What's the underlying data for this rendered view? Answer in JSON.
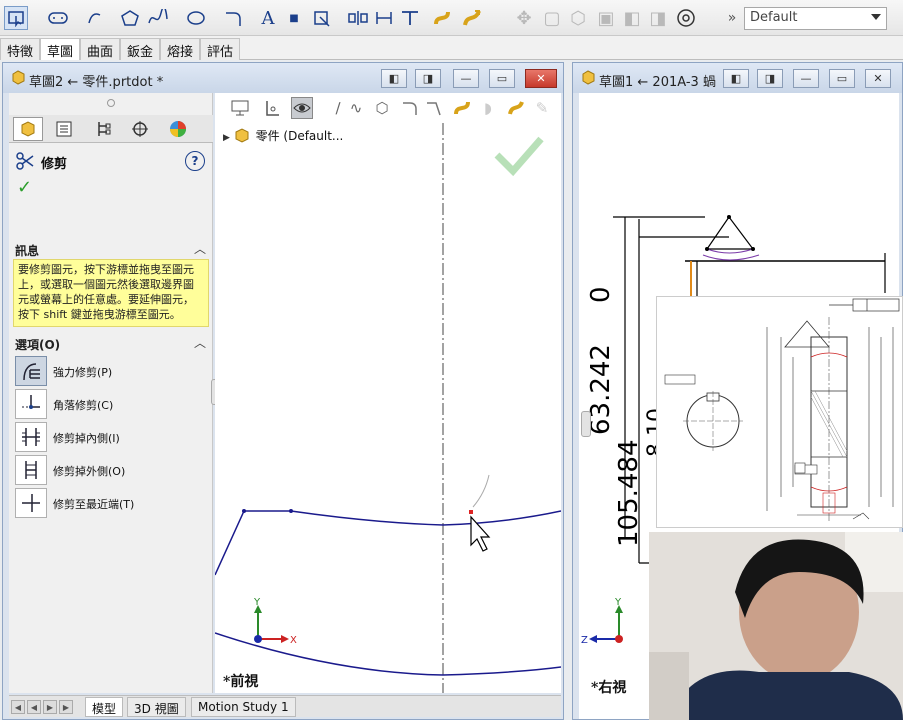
{
  "toolbar": {
    "config_value": "Default"
  },
  "command_tabs": [
    "特徵",
    "草圖",
    "曲面",
    "鈑金",
    "熔接",
    "評估"
  ],
  "left_window": {
    "title": "草圖2 ← 零件.prtdot *",
    "property_manager": {
      "feature_name": "修剪",
      "help": "?",
      "message_header": "訊息",
      "message_text": "要修剪圖元，按下游標並拖曳至圖元上，或選取一個圖元然後選取邊界圖元或螢幕上的任意處。要延伸圖元，按下 shift 鍵並拖曳游標至圖元。",
      "options_header": "選項(O)",
      "options": [
        {
          "label": "強力修剪(P)",
          "icon": "power-trim-icon",
          "selected": true
        },
        {
          "label": "角落修剪(C)",
          "icon": "corner-trim-icon",
          "selected": false
        },
        {
          "label": "修剪掉內側(I)",
          "icon": "trim-inside-icon",
          "selected": false
        },
        {
          "label": "修剪掉外側(O)",
          "icon": "trim-outside-icon",
          "selected": false
        },
        {
          "label": "修剪至最近端(T)",
          "icon": "trim-closest-icon",
          "selected": false
        }
      ]
    },
    "tree_root": "零件  (Default...",
    "view_label": "*前視",
    "bottom_tabs": [
      "模型",
      "3D 視圖",
      "Motion Study 1"
    ]
  },
  "right_window": {
    "title": "草圖1 ← 201A-3 蝸",
    "view_label": "*右視",
    "dimensions": [
      "0",
      "63.242",
      "105.484"
    ],
    "partial_dimension": "8 10"
  },
  "colors": {
    "accent": "#1b3f8b",
    "sketch_line": "#1a1a8c",
    "message_bg": "#fffe9a",
    "close_button": "#c6392b"
  }
}
